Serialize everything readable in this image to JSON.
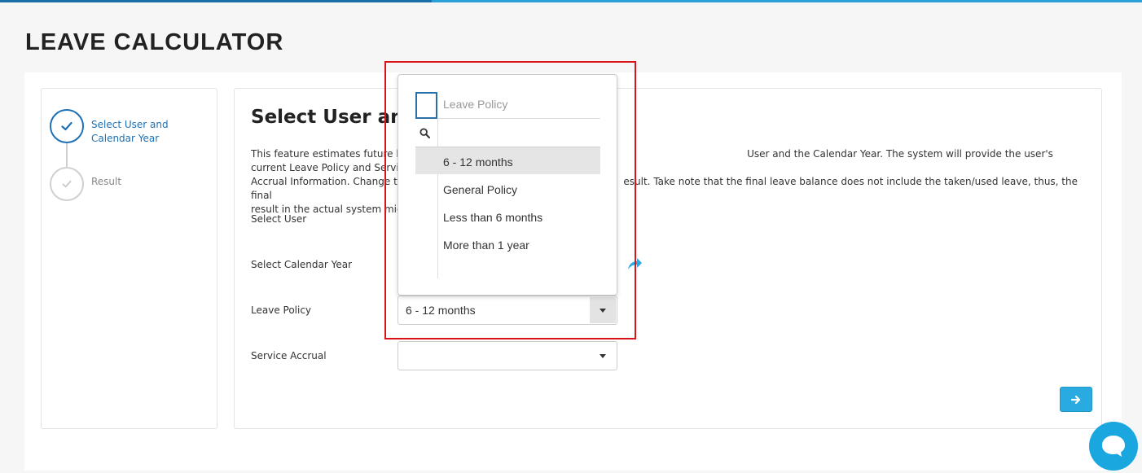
{
  "page": {
    "title": "LEAVE CALCULATOR"
  },
  "colors": {
    "accent": "#1c70b5",
    "brand": "#29abe2",
    "highlight": "#d9131a"
  },
  "steps": [
    {
      "label": "Select User and Calendar Year",
      "state": "active",
      "icon": "check-icon"
    },
    {
      "label": "Result",
      "state": "inactive",
      "icon": "check-icon"
    }
  ],
  "main": {
    "title": "Select User and Calendar Year",
    "description_visible_1": "This feature estimates future le",
    "description_visible_2": "User and the Calendar Year. The system will provide the user's current Leave Policy and Service",
    "description_visible_3": "Accrual Information. Change th",
    "description_visible_4": "esult. Take note that the final leave balance does not include the taken/used leave, thus, the final",
    "description_visible_5": "result in the actual system mig"
  },
  "form": {
    "user_label": "Select User",
    "year_label": "Select Calendar Year",
    "leave_policy_label": "Leave Policy",
    "leave_policy_value": "6 - 12 months",
    "service_accrual_label": "Service Accrual",
    "service_accrual_value": ""
  },
  "dropdown": {
    "heading": "Leave Policy",
    "options": [
      "6 - 12 months",
      "General Policy",
      "Less than 6 months",
      "More than 1 year"
    ],
    "selected": "6 - 12 months"
  }
}
